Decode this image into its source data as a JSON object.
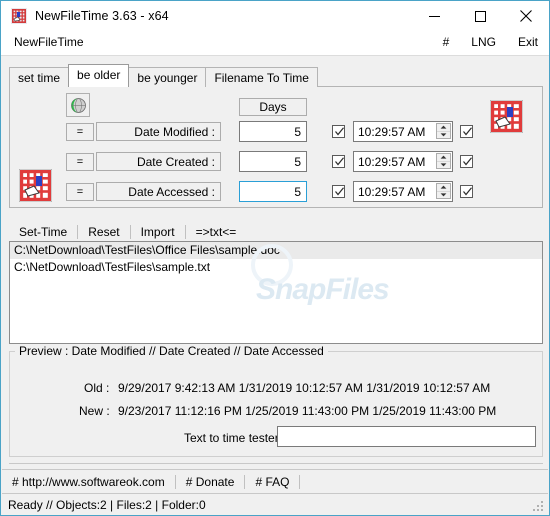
{
  "window": {
    "title": "NewFileTime 3.63 - x64",
    "icon": "app-grid-hand-icon",
    "controls": {
      "minimize": "minimize-icon",
      "maximize": "maximize-icon",
      "close": "close-icon"
    },
    "accent_border": "#4aa3c7"
  },
  "menubar": {
    "left_item": "NewFileTime",
    "right_items": [
      "#",
      "LNG",
      "Exit"
    ]
  },
  "tabs": [
    {
      "label": "set time",
      "active": false
    },
    {
      "label": "be older",
      "active": true
    },
    {
      "label": "be younger",
      "active": false
    },
    {
      "label": "Filename To Time",
      "active": false
    }
  ],
  "tabpage": {
    "globe_icon": "globe-refresh-icon",
    "grid_icon_right": "grid-hand-icon",
    "grid_icon_left": "grid-hand-icon",
    "days_header": "Days",
    "rows": [
      {
        "eq_button": "=",
        "label": "Date Modified :",
        "days_value": "5",
        "days_focused": false,
        "days_checked": true,
        "time_value": "10:29:57 AM",
        "time_checked": true
      },
      {
        "eq_button": "=",
        "label": "Date Created :",
        "days_value": "5",
        "days_focused": false,
        "days_checked": true,
        "time_value": "10:29:57 AM",
        "time_checked": true
      },
      {
        "eq_button": "=",
        "label": "Date Accessed :",
        "days_value": "5",
        "days_focused": true,
        "days_checked": true,
        "time_value": "10:29:57 AM",
        "time_checked": true
      }
    ]
  },
  "actionbar": [
    {
      "label": "Set-Time"
    },
    {
      "label": "Reset"
    },
    {
      "label": "Import"
    },
    {
      "label": "=>txt<="
    }
  ],
  "filelist": {
    "items": [
      {
        "path": "C:\\NetDownload\\TestFiles\\Office Files\\sample.doc",
        "selected": true
      },
      {
        "path": "C:\\NetDownload\\TestFiles\\sample.txt",
        "selected": false
      }
    ],
    "watermark": "SnapFiles"
  },
  "preview": {
    "title": "Preview :   Date Modified   //   Date Created   //   Date Accessed",
    "old_label": "Old :",
    "old_values": "9/29/2017 9:42:13 AM   1/31/2019 10:12:57 AM 1/31/2019 10:12:57 AM",
    "new_label": "New :",
    "new_values": "9/23/2017 11:12:16 PM 1/25/2019 11:43:00 PM 1/25/2019 11:43:00 PM",
    "tester_label": "Text to time tester",
    "tester_value": "",
    "tester_placeholder": ""
  },
  "bottomlinks": [
    {
      "label": "# http://www.softwareok.com"
    },
    {
      "label": "# Donate"
    },
    {
      "label": "# FAQ"
    }
  ],
  "statusbar": {
    "text": "Ready // Objects:2 | Files:2  | Folder:0"
  }
}
